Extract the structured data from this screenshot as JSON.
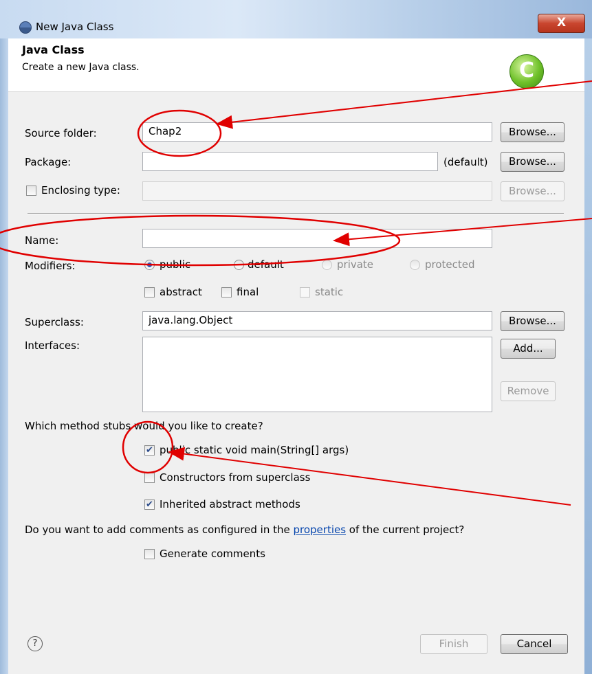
{
  "window": {
    "title": "New Java Class",
    "close_label": "X"
  },
  "banner": {
    "title": "Java Class",
    "subtitle": "Create a new Java class.",
    "icon_letter": "C"
  },
  "source_folder": {
    "label": "Source folder:",
    "value": "Chap2",
    "browse": "Browse..."
  },
  "package": {
    "label": "Package:",
    "value": "",
    "default_hint": "(default)",
    "browse": "Browse..."
  },
  "enclosing_type": {
    "label": "Enclosing type:",
    "value": "",
    "browse": "Browse..."
  },
  "name": {
    "label": "Name:",
    "value": ""
  },
  "modifiers": {
    "label": "Modifiers:",
    "public": "public",
    "default": "default",
    "private": "private",
    "protected": "protected",
    "abstract": "abstract",
    "final": "final",
    "static": "static"
  },
  "superclass": {
    "label": "Superclass:",
    "value": "java.lang.Object",
    "browse": "Browse..."
  },
  "interfaces": {
    "label": "Interfaces:",
    "add": "Add...",
    "remove": "Remove"
  },
  "stubs": {
    "question": "Which method stubs would you like to create?",
    "main": "public static void main(String[] args)",
    "constructors": "Constructors from superclass",
    "inherited": "Inherited abstract methods",
    "main_checked": true,
    "constructors_checked": false,
    "inherited_checked": true
  },
  "comments": {
    "question_pre": "Do you want to add comments as configured in the ",
    "link": "properties",
    "question_post": " of the current project?",
    "generate": "Generate comments",
    "checked": false
  },
  "footer": {
    "help": "?",
    "finish": "Finish",
    "cancel": "Cancel"
  },
  "colors": {
    "annotation": "#e00000",
    "link": "#0645ad"
  }
}
